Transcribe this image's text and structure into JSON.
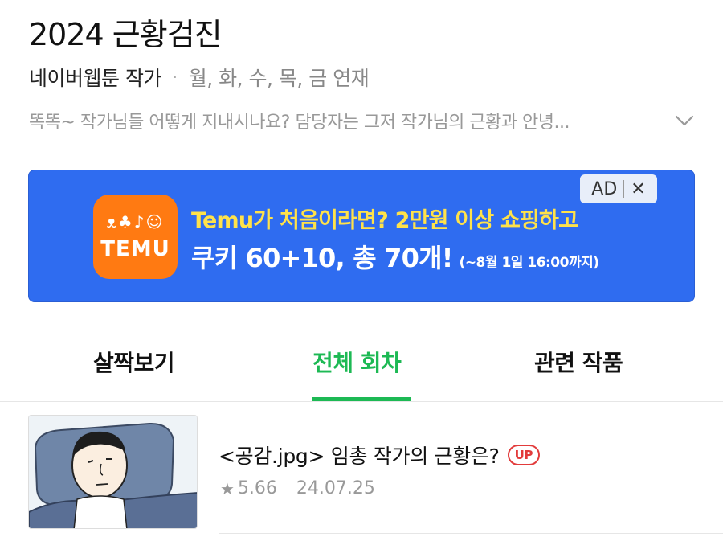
{
  "header": {
    "title": "2024 근황검진",
    "author": "네이버웹툰 작가",
    "dot": "·",
    "schedule": "월, 화, 수, 목, 금 연재",
    "description": "똑똑~ 작가님들 어떻게 지내시나요? 담당자는 그저 작가님의 근황과 안녕..."
  },
  "ad": {
    "badge_label": "AD",
    "close_glyph": "✕",
    "logo_glyphs": "ᴥ♣♪☺",
    "brand": "TEMU",
    "line1": "Temu가 처음이라면? 2만원 이상 쇼핑하고",
    "line2": "쿠키 60+10, 총 70개!",
    "line2_note": "(~8월 1일 16:00까지)",
    "colors": {
      "background": "#2f6cf0",
      "logo": "#ff7a12",
      "highlight": "#ffe24a"
    }
  },
  "tabs": [
    {
      "label": "살짝보기",
      "active": false
    },
    {
      "label": "전체 회차",
      "active": true
    },
    {
      "label": "관련 작품",
      "active": false
    }
  ],
  "accent_color": "#1db954",
  "episode": {
    "title": "<공감.jpg> 임총 작가의 근황은?",
    "badge": "UP",
    "rating": "5.66",
    "date": "24.07.25",
    "star_icon": "star-icon"
  }
}
